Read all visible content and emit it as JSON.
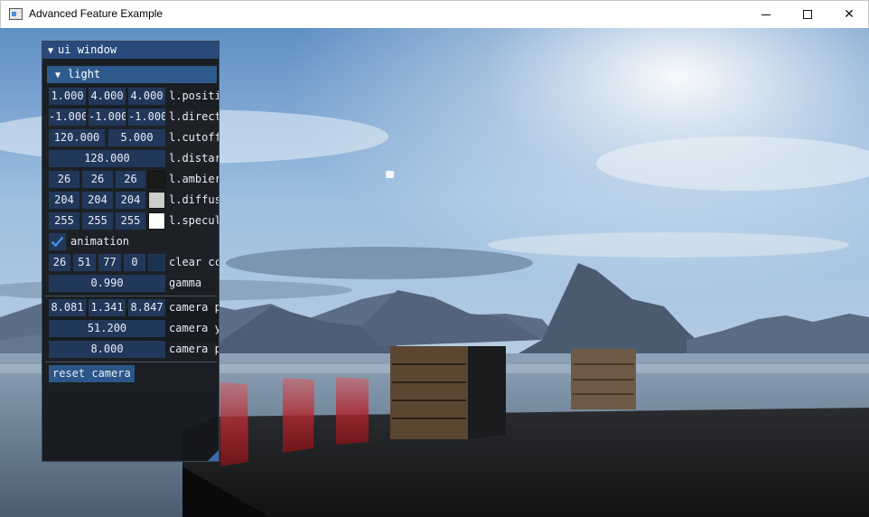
{
  "window": {
    "title": "Advanced Feature Example",
    "minimize_icon": "minimize-icon",
    "maximize_icon": "maximize-icon",
    "close_icon": "close-icon",
    "close_glyph": "✕"
  },
  "ui": {
    "title": "ui window",
    "light_header": "light",
    "arrow": "▼",
    "rows": {
      "position": {
        "values": [
          "1.000",
          "4.000",
          "4.000"
        ],
        "label": "l.positi"
      },
      "direction": {
        "values": [
          "-1.000",
          "-1.000",
          "-1.000"
        ],
        "label": "l.direct"
      },
      "cutoff": {
        "values": [
          "120.000",
          "5.000"
        ],
        "label": "l.cutoff"
      },
      "distance": {
        "value": "128.000",
        "label": "l.distar"
      },
      "ambient": {
        "values": [
          "26",
          "26",
          "26"
        ],
        "label": "l.ambier",
        "swatch": "#1a1a1a"
      },
      "diffuse": {
        "values": [
          "204",
          "204",
          "204"
        ],
        "label": "l.diffus",
        "swatch": "#cccccc"
      },
      "specular": {
        "values": [
          "255",
          "255",
          "255"
        ],
        "label": "l.specul",
        "swatch": "#ffffff"
      },
      "animation": {
        "label": "animation",
        "checked": true
      },
      "clear_color": {
        "values": [
          "26",
          "51",
          "77",
          "0"
        ],
        "label": "clear cc",
        "swatch": "#1a334d"
      },
      "gamma": {
        "value": "0.990",
        "label": "gamma"
      },
      "camera_pos": {
        "values": [
          "8.081",
          "1.341",
          "8.847"
        ],
        "label": "camera p"
      },
      "camera_yaw": {
        "value": "51.200",
        "label": "camera y"
      },
      "camera_pitch": {
        "value": "8.000",
        "label": "camera p"
      }
    },
    "reset_button": "reset camera"
  },
  "colors": {
    "accent": "#294a7a",
    "field": "#22385a",
    "check": "#4a90e8"
  }
}
